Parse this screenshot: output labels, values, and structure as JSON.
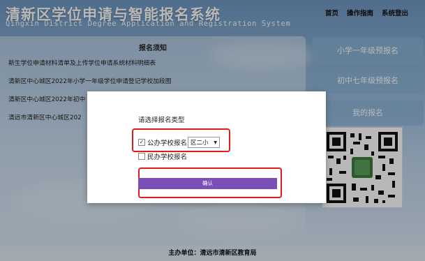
{
  "header": {
    "title": "清新区学位申请与智能报名系统",
    "subtitle": "Qingxin District Degree Application and Registration System",
    "nav": [
      "首页",
      "操作指南",
      "系统登出"
    ]
  },
  "notice": {
    "title": "报名须知",
    "items": [
      "新生学位申请材料清单及上传学位申请系统材料明细表",
      "清新区中心城区2022年小学一年级学位申请登记学校加段图",
      "清新区中心城区2022年初中",
      "清远市清新区中心城区202"
    ]
  },
  "side_menu": {
    "grade1": "小学一年级预报名",
    "grade7": "初中七年级预报名",
    "my": "我的报名"
  },
  "footer": {
    "text": "主办单位：清远市清新区教育局"
  },
  "modal": {
    "prompt": "请选择报名类型",
    "public_option": {
      "label": "公办学校报名",
      "checked": true,
      "check_glyph": "✓"
    },
    "school_select": {
      "value": "区二小"
    },
    "private_option": {
      "label": "民办学校报名",
      "checked": false,
      "check_glyph": ""
    },
    "confirm_label": "确认"
  },
  "colors": {
    "accent_purple": "#7b4fb8",
    "highlight_red": "#e11b1b"
  }
}
